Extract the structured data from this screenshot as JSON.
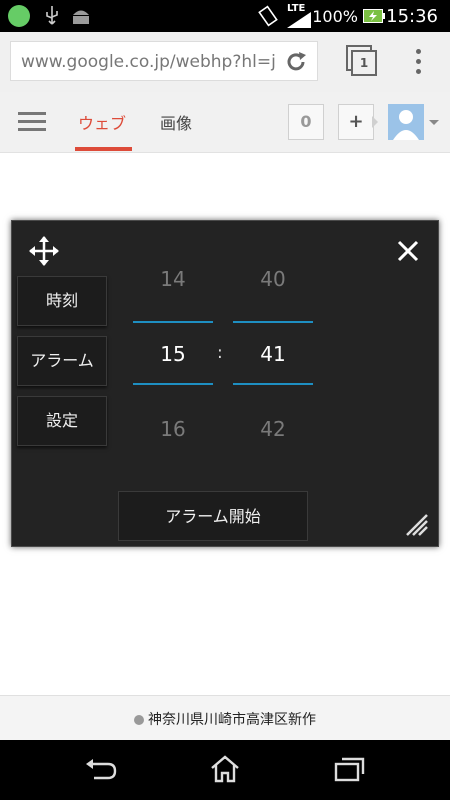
{
  "status_bar": {
    "network": "LTE",
    "battery_percent": "100%",
    "time": "15:36"
  },
  "browser": {
    "url": "www.google.co.jp/webhp?hl=ja",
    "tab_count": "1"
  },
  "google_header": {
    "tabs": [
      {
        "label": "ウェブ",
        "active": true
      },
      {
        "label": "画像",
        "active": false
      }
    ],
    "notification_count": "0",
    "share_label": "+"
  },
  "alarm_widget": {
    "side_buttons": [
      "時刻",
      "アラーム",
      "設定"
    ],
    "hour_column": {
      "prev": "14",
      "current": "15",
      "next": "16"
    },
    "minute_column": {
      "prev": "40",
      "current": "41",
      "next": "42"
    },
    "separator": ":",
    "start_button": "アラーム開始"
  },
  "location": {
    "text": "神奈川県川崎市高津区新作"
  },
  "colors": {
    "accent_red": "#dd4b39",
    "picker_blue": "#1e8fc2"
  }
}
